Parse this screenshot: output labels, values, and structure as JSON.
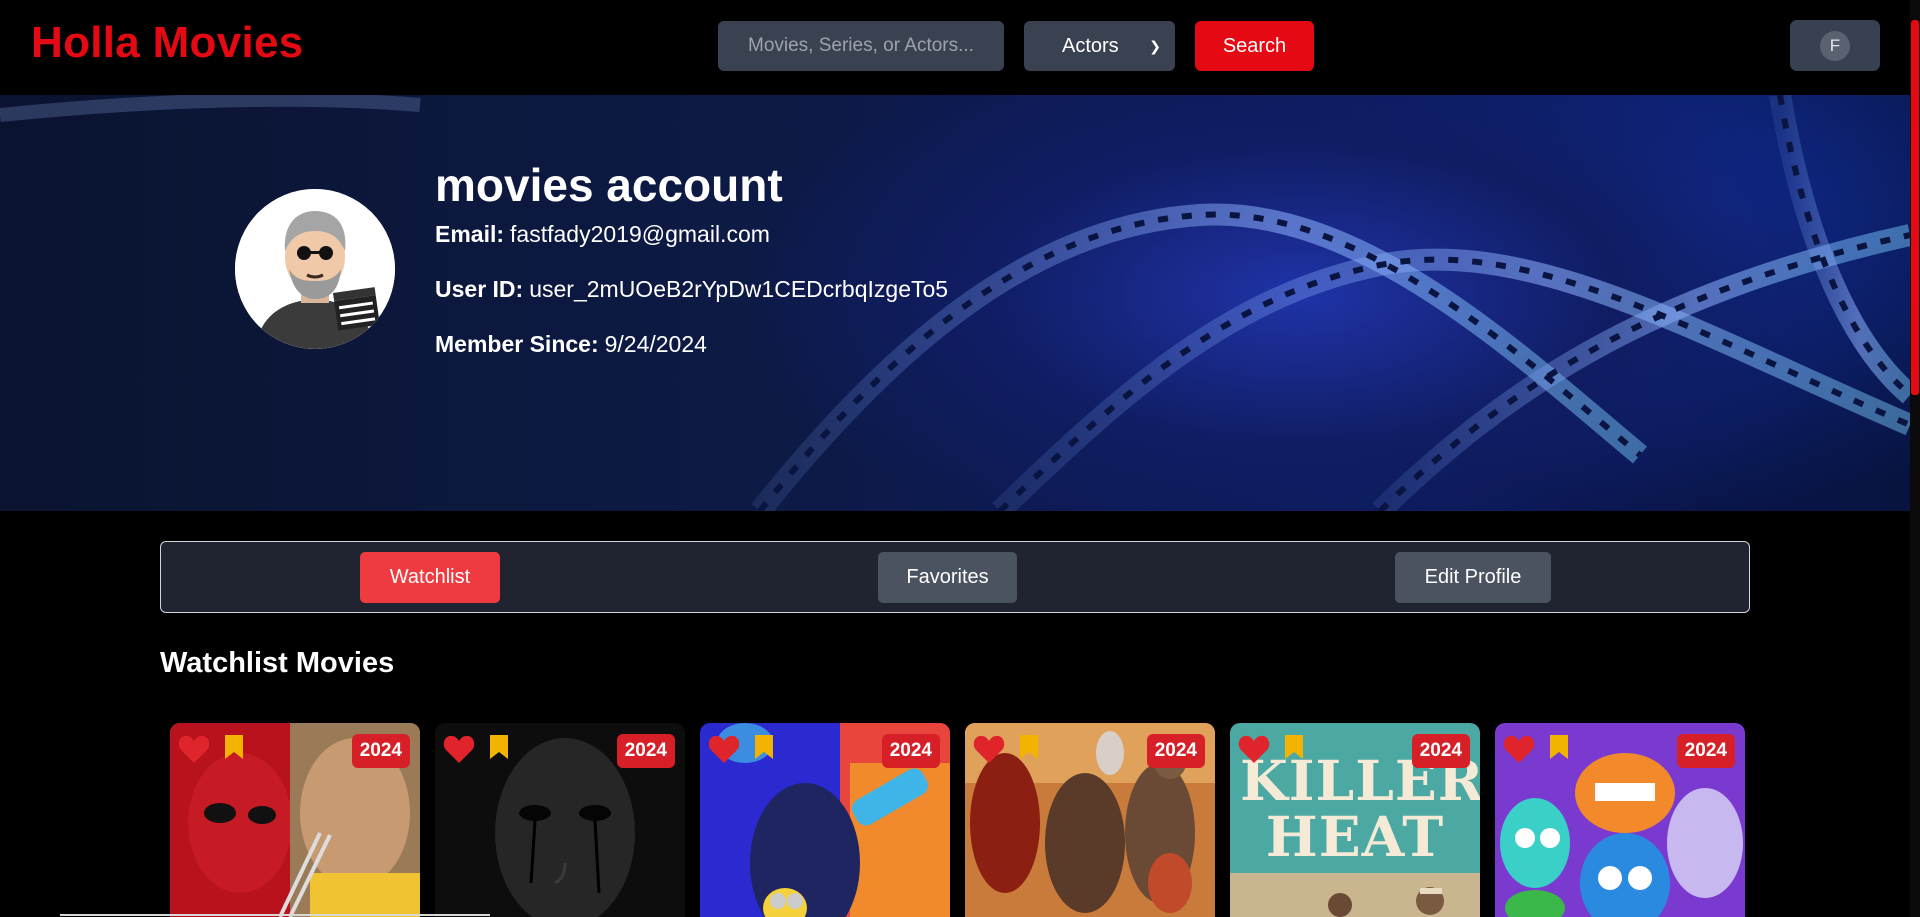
{
  "app": {
    "logo": "Holla Movies"
  },
  "search": {
    "placeholder": "Movies, Series, or Actors...",
    "type_selected": "Actors",
    "button_label": "Search"
  },
  "user_menu": {
    "initial": "F"
  },
  "profile": {
    "name": "movies account",
    "email_label": "Email:",
    "email": "fastfady2019@gmail.com",
    "user_id_label": "User ID:",
    "user_id": "user_2mUOeB2rYpDw1CEDcrbqIzgeTo5",
    "member_since_label": "Member Since:",
    "member_since": "9/24/2024"
  },
  "tabs": [
    {
      "label": "Watchlist",
      "active": true
    },
    {
      "label": "Favorites",
      "active": false
    },
    {
      "label": "Edit Profile",
      "active": false
    }
  ],
  "section": {
    "title": "Watchlist Movies"
  },
  "movies": [
    {
      "year": "2024"
    },
    {
      "year": "2024"
    },
    {
      "year": "2024"
    },
    {
      "year": "2024"
    },
    {
      "year": "2024",
      "poster_text": "KILLER HEAT"
    },
    {
      "year": "2024"
    }
  ],
  "colors": {
    "brand": "#e50914",
    "active_tab": "#ef3b3f",
    "heart": "#e0242b",
    "bookmark": "#f2b400"
  }
}
